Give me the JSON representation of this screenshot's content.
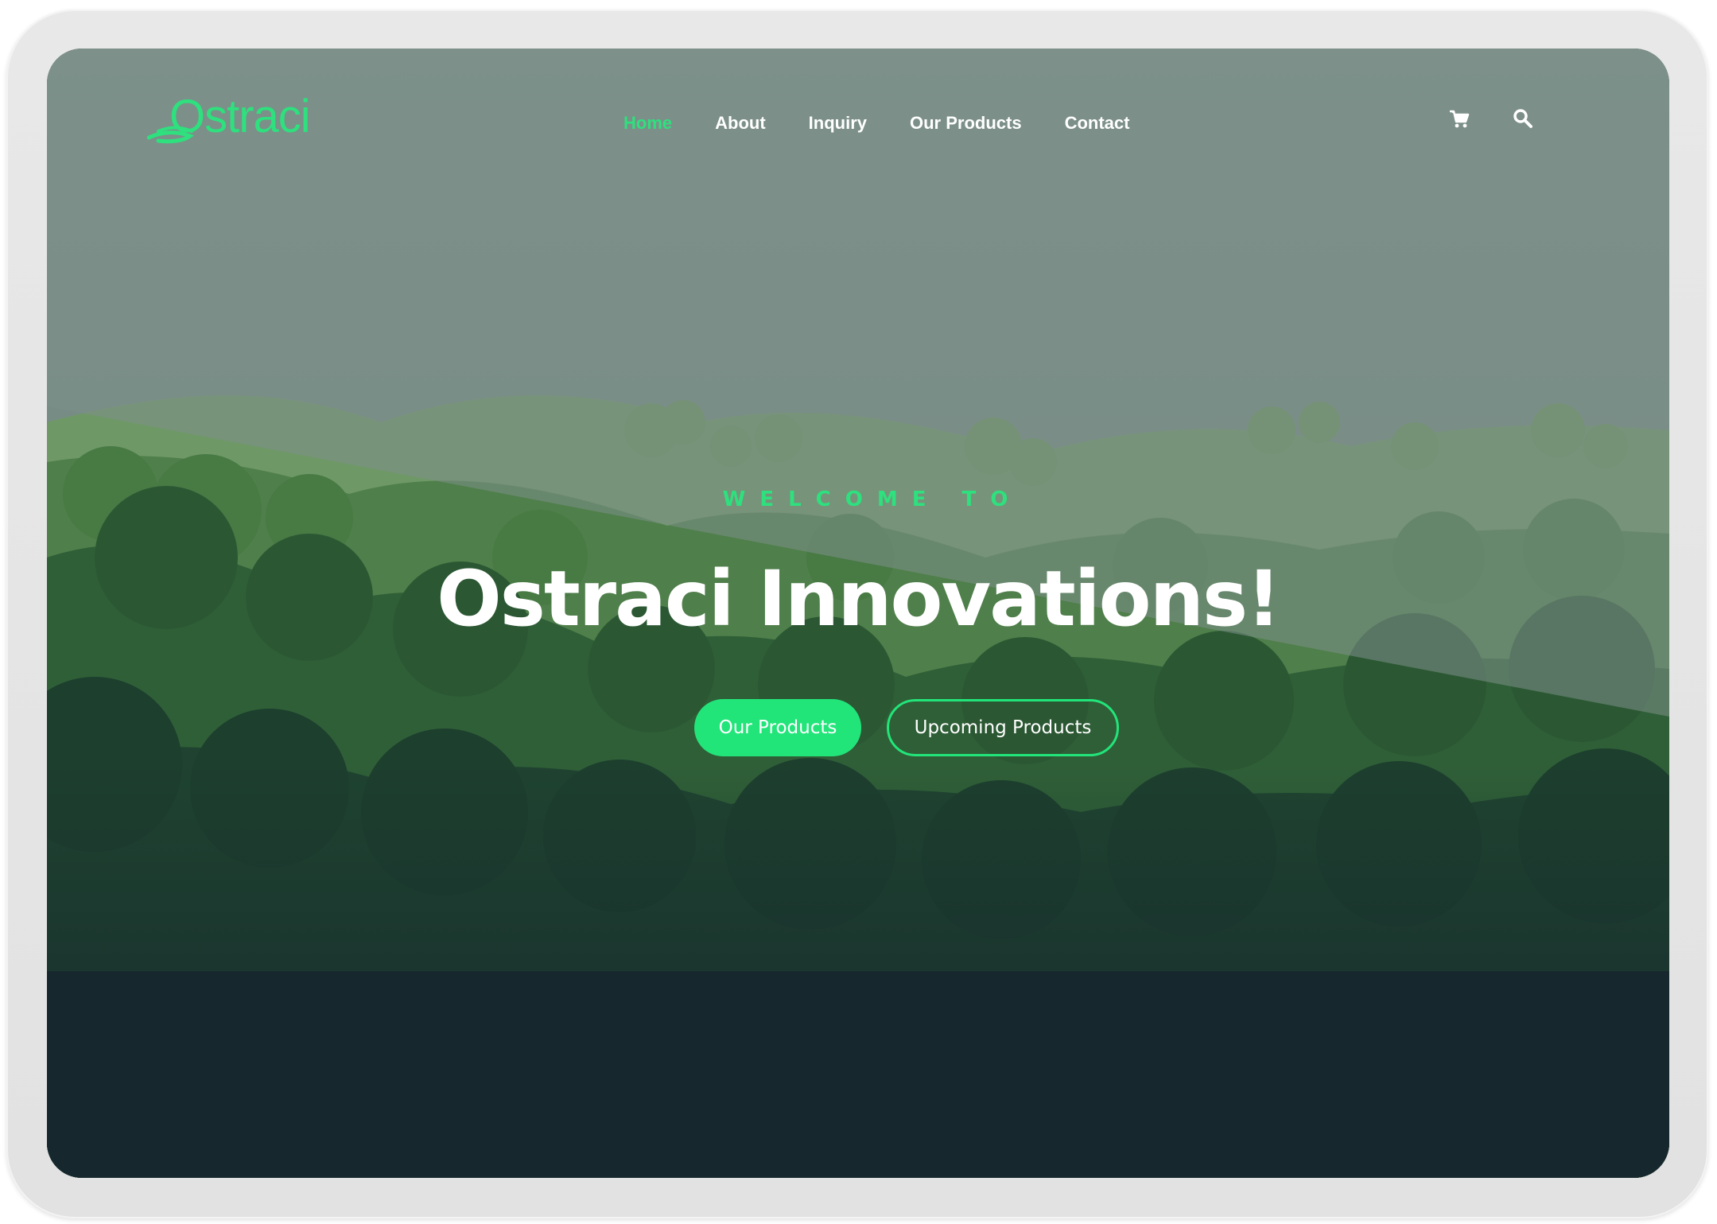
{
  "brand": {
    "logo_text": "Ostraci",
    "accent_color": "#2ee07e"
  },
  "nav": {
    "items": [
      {
        "label": "Home",
        "active": true
      },
      {
        "label": "About",
        "active": false
      },
      {
        "label": "Inquiry",
        "active": false
      },
      {
        "label": "Our Products",
        "active": false
      },
      {
        "label": "Contact",
        "active": false
      }
    ],
    "icons": [
      "cart-icon",
      "search-icon"
    ]
  },
  "hero": {
    "subtitle": "WELCOME TO",
    "title": "Ostraci Innovations!",
    "primary_button": "Our Products",
    "secondary_button": "Upcoming Products"
  }
}
